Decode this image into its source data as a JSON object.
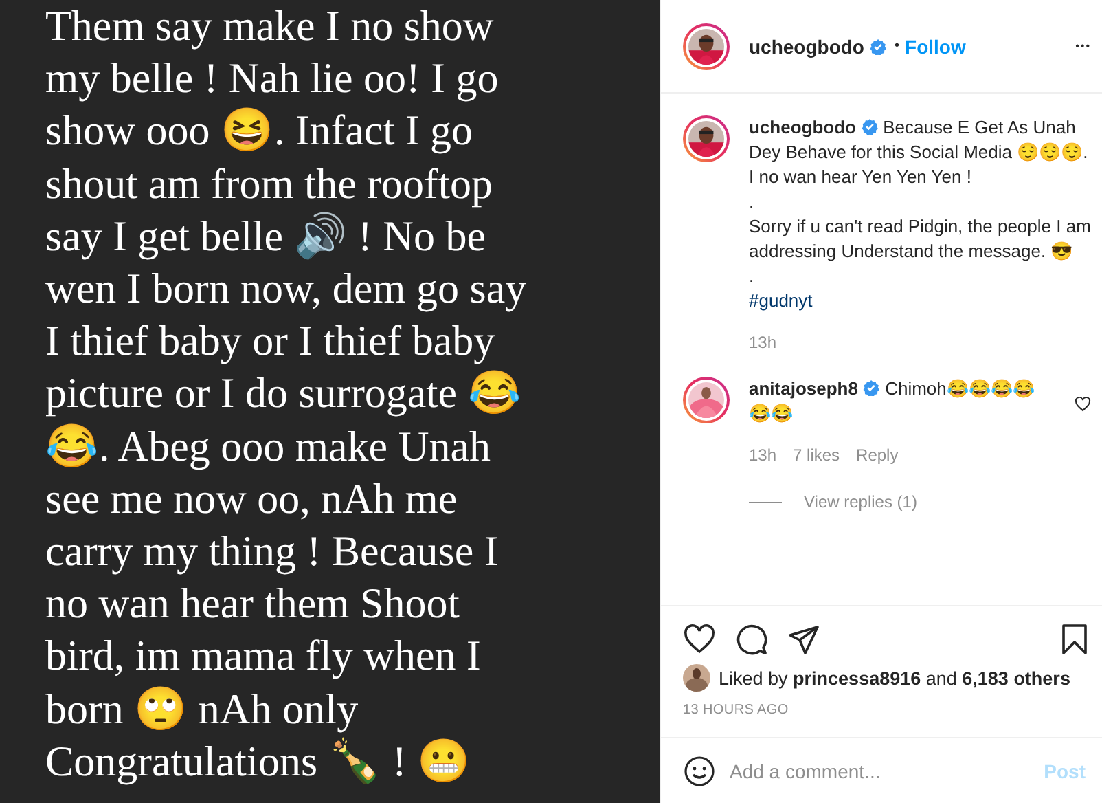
{
  "post_image": {
    "lines": [
      "Them say make I no show",
      "my belle ! Nah lie oo! I go",
      "show ooo 😆. Infact I go",
      "shout am from the rooftop",
      "say I get belle 🔊 ! No be",
      "wen I born now, dem go say",
      "I thief baby or I thief baby",
      "picture or I do surrogate 😂",
      "😂. Abeg ooo make Unah",
      "see me now oo, nAh me",
      "carry my thing ! Because I",
      "no wan hear them Shoot",
      "bird, im mama fly when I",
      "born 🙄 nAh only",
      "Congratulations 🍾 ! 😬"
    ]
  },
  "header": {
    "username": "ucheogbodo",
    "verified": true,
    "separator": "•",
    "follow": "Follow",
    "more": "•••"
  },
  "caption": {
    "username": "ucheogbodo",
    "verified": true,
    "paragraphs": [
      "Because E Get As Unah Dey Behave for this Social Media 😌😌😌. I no wan hear Yen Yen Yen !",
      ".",
      "Sorry if u can't read Pidgin, the people I am addressing Understand the message. 😎",
      "."
    ],
    "hashtag": "#gudnyt",
    "time": "13h"
  },
  "comments": [
    {
      "username": "anitajoseph8",
      "verified": true,
      "text": "Chimoh😂😂😂😂😂😂",
      "time": "13h",
      "likes": "7 likes",
      "reply": "Reply",
      "liked": false,
      "view_replies": "View replies (1)"
    }
  ],
  "actions": {
    "liked": false,
    "saved": false
  },
  "likes": {
    "prefix": "Liked by",
    "user": "princessa8916",
    "middle": "and",
    "count": "6,183 others"
  },
  "timestamp": "13 HOURS AGO",
  "comment_box": {
    "placeholder": "Add a comment...",
    "post": "Post",
    "disabled": true
  }
}
